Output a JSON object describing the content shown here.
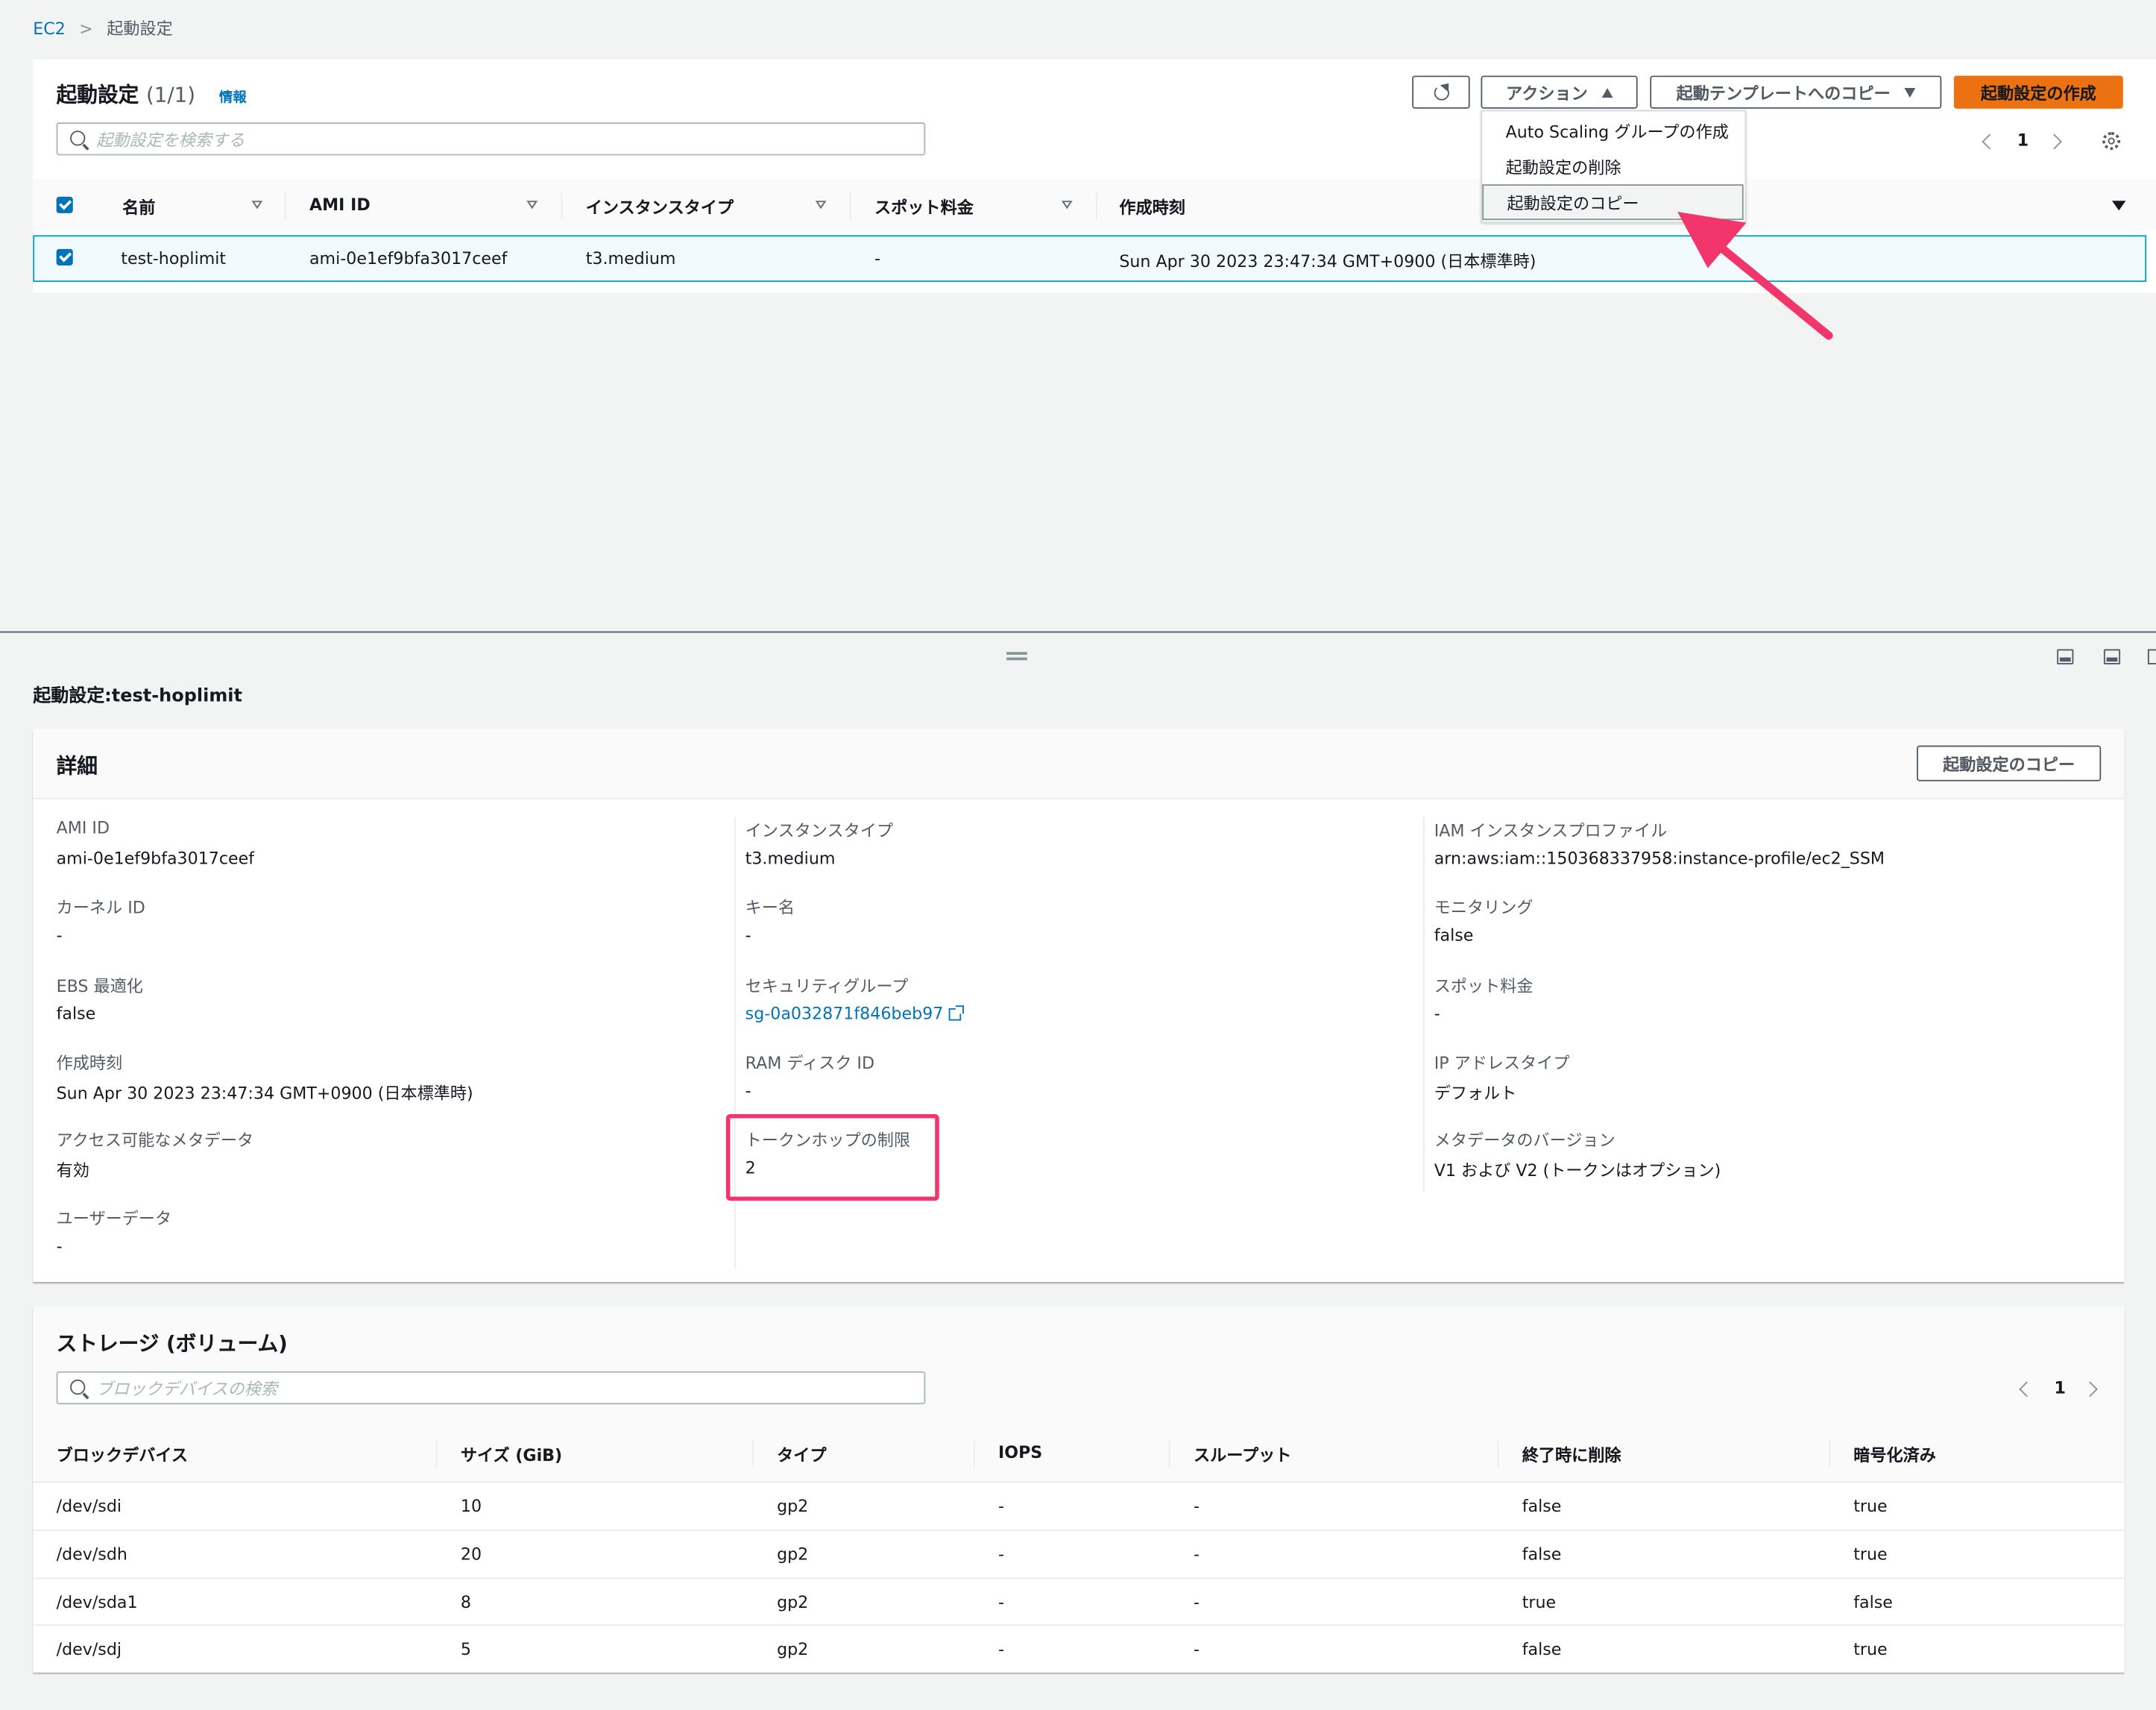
{
  "breadcrumb": {
    "root": "EC2",
    "current": "起動設定"
  },
  "list": {
    "title": "起動設定",
    "count": "(1/1)",
    "info": "情報",
    "search_placeholder": "起動設定を検索する",
    "buttons": {
      "actions": "アクション",
      "copy_to_template": "起動テンプレートへのコピー",
      "create": "起動設定の作成"
    },
    "actions_menu": [
      "Auto Scaling グループの作成",
      "起動設定の削除",
      "起動設定のコピー"
    ],
    "page": "1",
    "columns": [
      "名前",
      "AMI ID",
      "インスタンスタイプ",
      "スポット料金",
      "作成時刻"
    ],
    "rows": [
      {
        "name": "test-hoplimit",
        "ami": "ami-0e1ef9bfa3017ceef",
        "type": "t3.medium",
        "spot": "-",
        "created": "Sun Apr 30 2023 23:47:34 GMT+0900 (日本標準時)"
      }
    ]
  },
  "detail": {
    "heading": "起動設定:test-hoplimit",
    "section_title": "詳細",
    "copy_button": "起動設定のコピー",
    "col1": [
      {
        "label": "AMI ID",
        "value": "ami-0e1ef9bfa3017ceef"
      },
      {
        "label": "カーネル ID",
        "value": "-"
      },
      {
        "label": "EBS 最適化",
        "value": "false"
      },
      {
        "label": "作成時刻",
        "value": "Sun Apr 30 2023 23:47:34 GMT+0900 (日本標準時)"
      },
      {
        "label": "アクセス可能なメタデータ",
        "value": "有効"
      },
      {
        "label": "ユーザーデータ",
        "value": "-"
      }
    ],
    "col2": [
      {
        "label": "インスタンスタイプ",
        "value": "t3.medium"
      },
      {
        "label": "キー名",
        "value": "-"
      },
      {
        "label": "セキュリティグループ",
        "value": "sg-0a032871f846beb97"
      },
      {
        "label": "RAM ディスク ID",
        "value": "-"
      },
      {
        "label": "トークンホップの制限",
        "value": "2"
      }
    ],
    "col3": [
      {
        "label": "IAM インスタンスプロファイル",
        "value": "arn:aws:iam::150368337958:instance-profile/ec2_SSM"
      },
      {
        "label": "モニタリング",
        "value": "false"
      },
      {
        "label": "スポット料金",
        "value": "-"
      },
      {
        "label": "IP アドレスタイプ",
        "value": "デフォルト"
      },
      {
        "label": "メタデータのバージョン",
        "value": "V1 および V2 (トークンはオプション)"
      }
    ]
  },
  "storage": {
    "title": "ストレージ (ボリューム)",
    "search_placeholder": "ブロックデバイスの検索",
    "page": "1",
    "columns": [
      "ブロックデバイス",
      "サイズ (GiB)",
      "タイプ",
      "IOPS",
      "スループット",
      "終了時に削除",
      "暗号化済み"
    ],
    "rows": [
      [
        "/dev/sdi",
        "10",
        "gp2",
        "-",
        "-",
        "false",
        "true"
      ],
      [
        "/dev/sdh",
        "20",
        "gp2",
        "-",
        "-",
        "false",
        "true"
      ],
      [
        "/dev/sda1",
        "8",
        "gp2",
        "-",
        "-",
        "true",
        "false"
      ],
      [
        "/dev/sdj",
        "5",
        "gp2",
        "-",
        "-",
        "false",
        "true"
      ]
    ]
  },
  "colors": {
    "accent": "#ec7211",
    "link": "#0073bb",
    "annotation": "#f2366c"
  }
}
